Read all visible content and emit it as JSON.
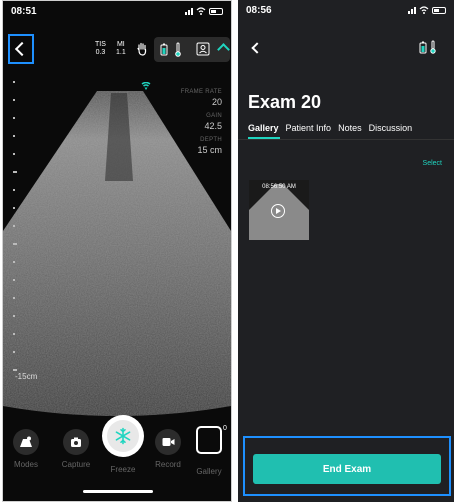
{
  "left": {
    "status": {
      "time": "08:51"
    },
    "safety": {
      "tis_label": "TIS",
      "tis_value": "0.3",
      "mi_label": "MI",
      "mi_value": "1.1"
    },
    "params": {
      "frame_rate_label": "FRAME RATE",
      "frame_rate": "20",
      "gain_label": "GAIN",
      "gain": "42.5",
      "depth_label": "DEPTH",
      "depth": "15 cm"
    },
    "scale_label": "-15cm",
    "controls": {
      "modes": "Modes",
      "capture": "Capture",
      "freeze": "Freeze",
      "record": "Record",
      "gallery": "Gallery"
    },
    "gallery_count": "0",
    "accent": "#20d5c0",
    "icons": [
      "back-icon",
      "hand-icon",
      "battery-probe-icon",
      "temperature-icon",
      "user-id-icon",
      "chevron-up-icon",
      "probe-signal-icon",
      "camera-icon",
      "snowflake-icon",
      "video-icon"
    ]
  },
  "right": {
    "status": {
      "time": "08:56"
    },
    "title": "Exam 20",
    "tabs": [
      "Gallery",
      "Patient Info",
      "Notes",
      "Discussion"
    ],
    "active_tab": "Gallery",
    "select_label": "Select",
    "thumbnail": {
      "time": "08:56:50 AM"
    },
    "end_exam_label": "End Exam",
    "button_color": "#20bfb0",
    "highlight_color": "#1e90ff"
  }
}
